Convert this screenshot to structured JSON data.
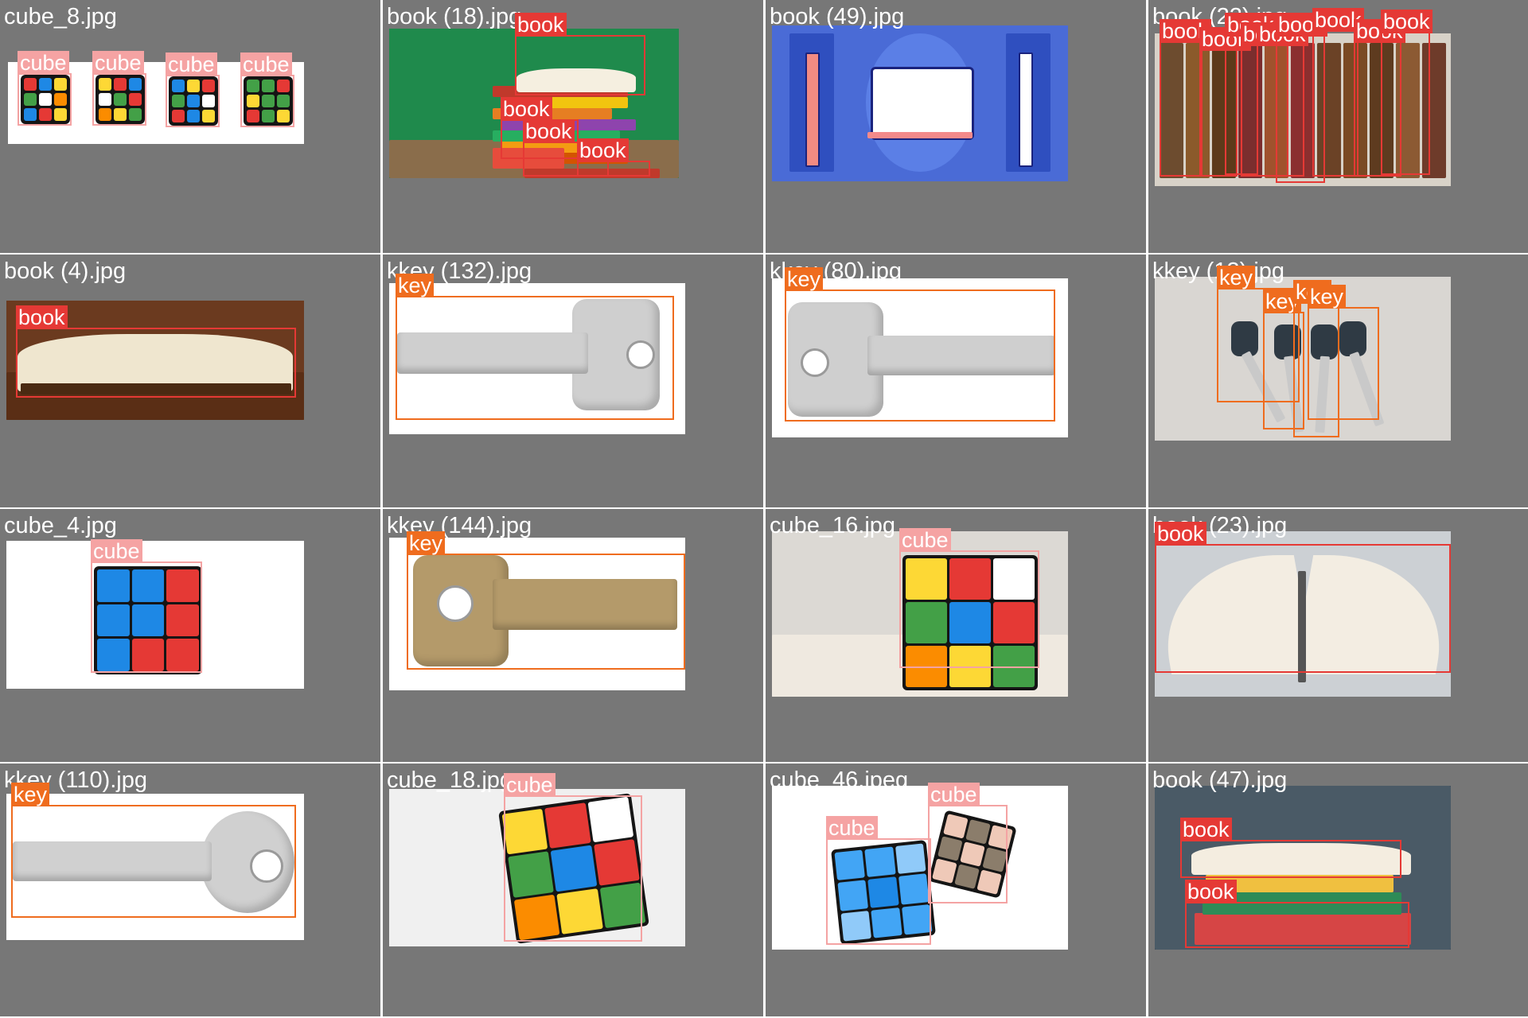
{
  "colors": {
    "book": "#e53935",
    "book_tag": "#e53935",
    "cube": "#f4a3a3",
    "cube_tag": "#f5a3a3",
    "key": "#ef6c1e",
    "key_tag": "#ef6c1e",
    "cell_bg": "#777777"
  },
  "icons": {
    "cube": "rubiks-cube-icon",
    "book": "book-icon",
    "key": "key-icon"
  },
  "cells": [
    {
      "filename": "cube_8.jpg",
      "labels": [
        "cube",
        "cube",
        "cube",
        "cube"
      ]
    },
    {
      "filename": "book (18).jpg",
      "labels": [
        "book",
        "book",
        "book",
        "book"
      ]
    },
    {
      "filename": "book (49).jpg",
      "labels": []
    },
    {
      "filename": "book (22).jpg",
      "labels": [
        "book",
        "book",
        "book",
        "book",
        "book",
        "book",
        "book",
        "book",
        "book"
      ]
    },
    {
      "filename": "book (4).jpg",
      "labels": [
        "book"
      ]
    },
    {
      "filename": "kkey (132).jpg",
      "labels": [
        "key"
      ]
    },
    {
      "filename": "kkey (80).jpg",
      "labels": [
        "key"
      ]
    },
    {
      "filename": "kkey (13).jpg",
      "labels": [
        "key",
        "key",
        "key",
        "key"
      ]
    },
    {
      "filename": "cube_4.jpg",
      "labels": [
        "cube"
      ]
    },
    {
      "filename": "kkey (144).jpg",
      "labels": [
        "key"
      ]
    },
    {
      "filename": "cube_16.jpg",
      "labels": [
        "cube"
      ]
    },
    {
      "filename": "book (23).jpg",
      "labels": [
        "book"
      ]
    },
    {
      "filename": "kkey (110).jpg",
      "labels": [
        "key"
      ]
    },
    {
      "filename": "cube_18.jpg",
      "labels": [
        "cube"
      ]
    },
    {
      "filename": "cube_46.jpeg",
      "labels": [
        "cube",
        "cube"
      ]
    },
    {
      "filename": "book (47).jpg",
      "labels": [
        "book",
        "book"
      ]
    }
  ]
}
